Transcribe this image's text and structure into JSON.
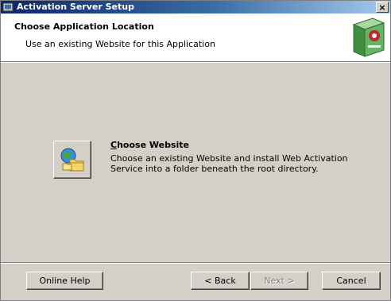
{
  "window": {
    "title": "Activation Server Setup",
    "close_label": "×"
  },
  "banner": {
    "title": "Choose Application Location",
    "subtitle": "Use an existing Website for this Application"
  },
  "option": {
    "icon": "website-folder-icon",
    "title_first": "C",
    "title_rest": "hoose Website",
    "description": "Choose an existing Website and install Web Activation Service into a folder beneath the root directory."
  },
  "buttons": {
    "help": "Online Help",
    "back": "< Back",
    "next": "Next >",
    "cancel": "Cancel"
  },
  "colors": {
    "titlebar_start": "#0a246a",
    "titlebar_end": "#a6caf0",
    "dialog_bg": "#d4d0c8"
  }
}
